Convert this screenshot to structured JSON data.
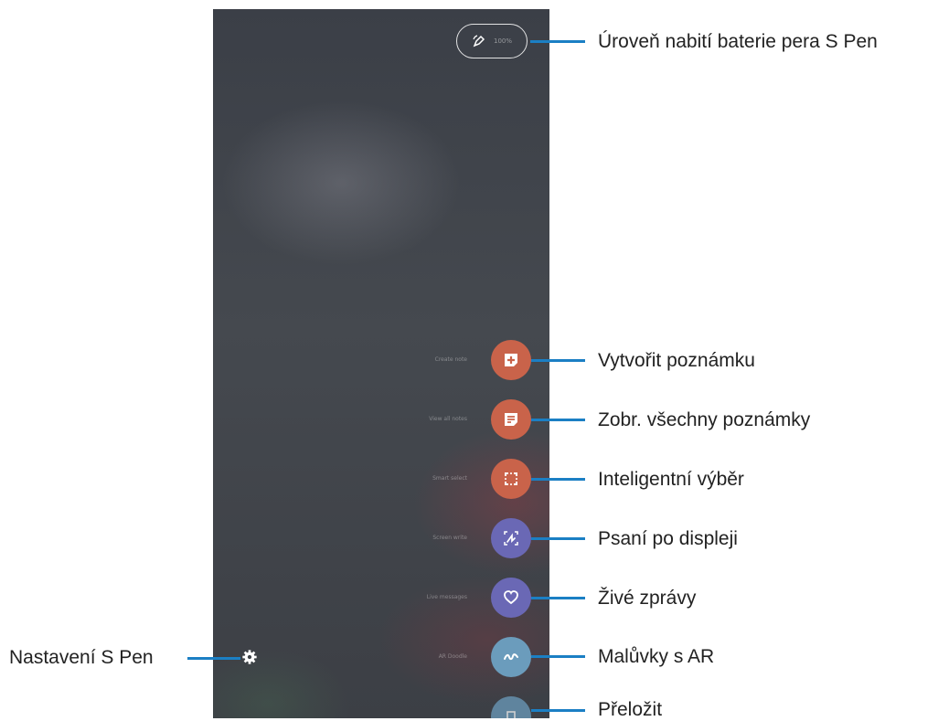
{
  "phone": {
    "battery": {
      "percent_text": "100%"
    },
    "menu": [
      {
        "id": "create-note",
        "label": "Create note",
        "color": "#c9634a"
      },
      {
        "id": "view-all-notes",
        "label": "View all notes",
        "color": "#c9634a"
      },
      {
        "id": "smart-select",
        "label": "Smart select",
        "color": "#c9634a"
      },
      {
        "id": "screen-write",
        "label": "Screen write",
        "color": "#6a68b5"
      },
      {
        "id": "live-messages",
        "label": "Live messages",
        "color": "#6a68b5"
      },
      {
        "id": "ar-doodle",
        "label": "AR Doodle",
        "color": "#6b9cbc"
      },
      {
        "id": "translate",
        "label": "",
        "color": "#6b9cbc"
      }
    ]
  },
  "callouts": {
    "battery": "Úroveň nabití baterie pera S Pen",
    "create_note": "Vytvořit poznámku",
    "view_all_notes": "Zobr. všechny poznámky",
    "smart_select": "Inteligentní výběr",
    "screen_write": "Psaní po displeji",
    "live_messages": "Živé zprávy",
    "ar_doodle": "Malůvky s AR",
    "translate": "Přeložit",
    "settings": "Nastavení S Pen"
  },
  "icons": {
    "pen": "pen-icon",
    "create_note": "note-plus-icon",
    "view_all_notes": "notes-list-icon",
    "smart_select": "selection-frame-icon",
    "screen_write": "screen-write-icon",
    "live_messages": "heart-icon",
    "ar_doodle": "doodle-icon",
    "translate": "translate-icon",
    "settings": "gear-icon"
  },
  "colors": {
    "callout_line": "#1b7fc4",
    "orange_button": "#c9634a",
    "purple_button": "#6a68b5",
    "blue_button": "#6b9cbc"
  }
}
